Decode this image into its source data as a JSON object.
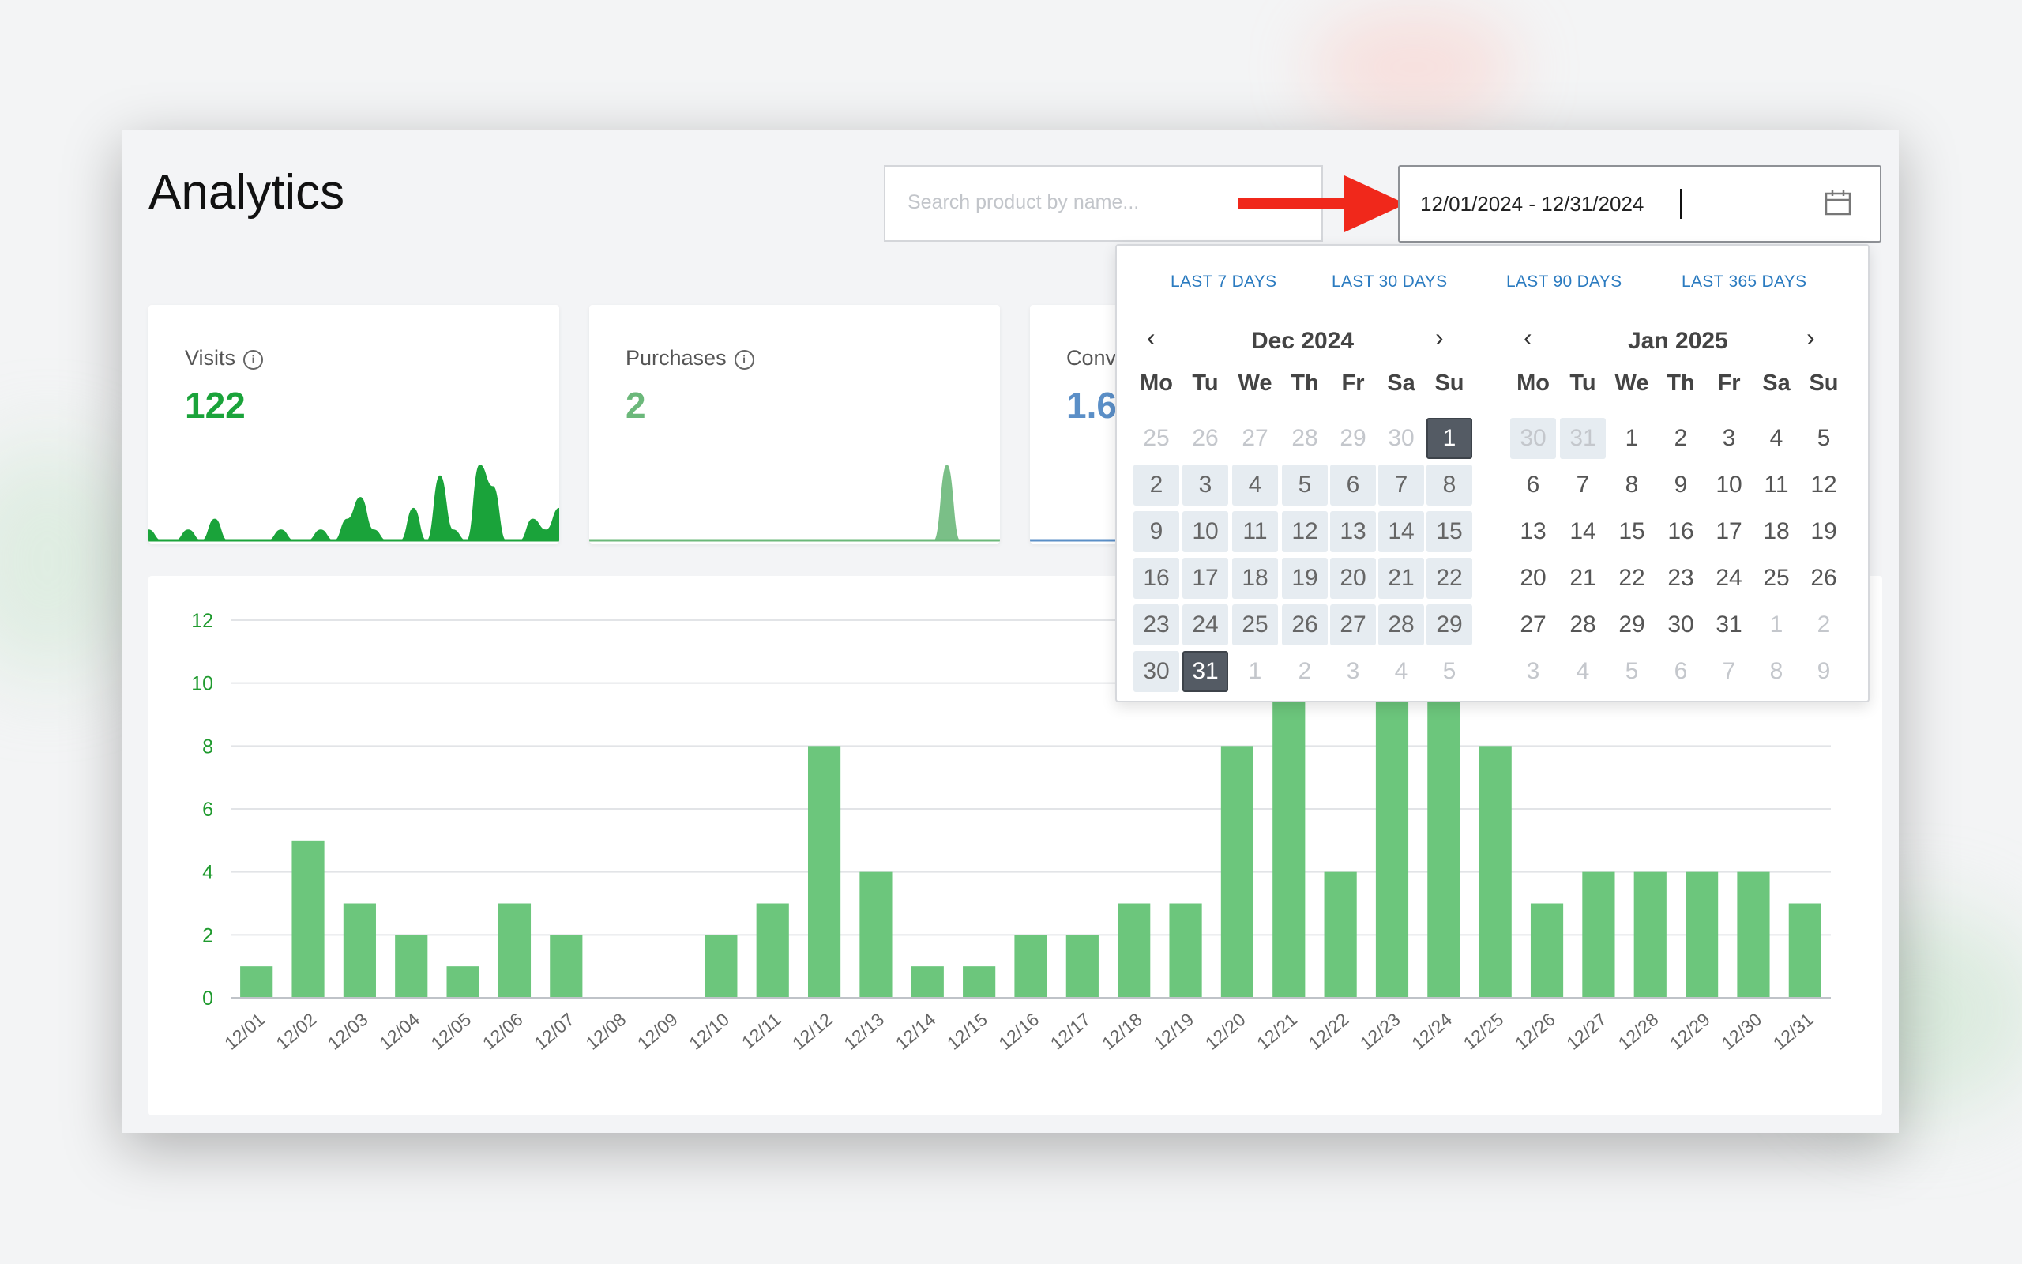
{
  "page": {
    "title": "Analytics"
  },
  "search": {
    "placeholder": "Search product by name..."
  },
  "date_range": {
    "value": "12/01/2024 - 12/31/2024"
  },
  "cards": [
    {
      "label": "Visits",
      "value": "122",
      "color": "#1aa33a",
      "spark": [
        1,
        0,
        0,
        1,
        0,
        2,
        0,
        0,
        0,
        0,
        1,
        0,
        0,
        1,
        0,
        2,
        4,
        1,
        0,
        0,
        3,
        0,
        6,
        1,
        0,
        7,
        5,
        0,
        0,
        2,
        1,
        3
      ]
    },
    {
      "label": "Purchases",
      "value": "2",
      "color": "#6bb87a",
      "spark": [
        0,
        0,
        0,
        0,
        0,
        0,
        0,
        0,
        0,
        0,
        0,
        0,
        0,
        0,
        0,
        0,
        0,
        0,
        0,
        0,
        0,
        0,
        0,
        0,
        0,
        0,
        0,
        2,
        0,
        0,
        0,
        0
      ]
    },
    {
      "label": "Conv",
      "value": "1.6",
      "color": "#5b8fc7",
      "spark": [
        0,
        0,
        0,
        0,
        0,
        0,
        0,
        0,
        0,
        0,
        0,
        0,
        0,
        0,
        0,
        0,
        0,
        0,
        0,
        0,
        0,
        0,
        0,
        0,
        0,
        0,
        0,
        0,
        0,
        0,
        0,
        0
      ]
    }
  ],
  "calendar": {
    "presets": [
      "LAST 7 DAYS",
      "LAST 30 DAYS",
      "LAST 90 DAYS",
      "LAST 365 DAYS"
    ],
    "prev_icon": "chevron-left-icon",
    "next_icon": "chevron-right-icon",
    "weekdays": [
      "Mo",
      "Tu",
      "We",
      "Th",
      "Fr",
      "Sa",
      "Su"
    ],
    "months": [
      {
        "title": "Dec 2024",
        "days": [
          {
            "d": "25",
            "s": "out"
          },
          {
            "d": "26",
            "s": "out"
          },
          {
            "d": "27",
            "s": "out"
          },
          {
            "d": "28",
            "s": "out"
          },
          {
            "d": "29",
            "s": "out"
          },
          {
            "d": "30",
            "s": "out"
          },
          {
            "d": "1",
            "s": "sel"
          },
          {
            "d": "2",
            "s": "rng"
          },
          {
            "d": "3",
            "s": "rng"
          },
          {
            "d": "4",
            "s": "rng"
          },
          {
            "d": "5",
            "s": "rng"
          },
          {
            "d": "6",
            "s": "rng"
          },
          {
            "d": "7",
            "s": "rng"
          },
          {
            "d": "8",
            "s": "rng"
          },
          {
            "d": "9",
            "s": "rng"
          },
          {
            "d": "10",
            "s": "rng"
          },
          {
            "d": "11",
            "s": "rng"
          },
          {
            "d": "12",
            "s": "rng"
          },
          {
            "d": "13",
            "s": "rng"
          },
          {
            "d": "14",
            "s": "rng"
          },
          {
            "d": "15",
            "s": "rng"
          },
          {
            "d": "16",
            "s": "rng"
          },
          {
            "d": "17",
            "s": "rng"
          },
          {
            "d": "18",
            "s": "rng"
          },
          {
            "d": "19",
            "s": "rng"
          },
          {
            "d": "20",
            "s": "rng"
          },
          {
            "d": "21",
            "s": "rng"
          },
          {
            "d": "22",
            "s": "rng"
          },
          {
            "d": "23",
            "s": "rng"
          },
          {
            "d": "24",
            "s": "rng"
          },
          {
            "d": "25",
            "s": "rng"
          },
          {
            "d": "26",
            "s": "rng"
          },
          {
            "d": "27",
            "s": "rng"
          },
          {
            "d": "28",
            "s": "rng"
          },
          {
            "d": "29",
            "s": "rng"
          },
          {
            "d": "30",
            "s": "rng"
          },
          {
            "d": "31",
            "s": "sel"
          },
          {
            "d": "1",
            "s": "out"
          },
          {
            "d": "2",
            "s": "out"
          },
          {
            "d": "3",
            "s": "out"
          },
          {
            "d": "4",
            "s": "out"
          },
          {
            "d": "5",
            "s": "out"
          }
        ]
      },
      {
        "title": "Jan 2025",
        "days": [
          {
            "d": "30",
            "s": "outrng"
          },
          {
            "d": "31",
            "s": "outrng"
          },
          {
            "d": "1",
            "s": ""
          },
          {
            "d": "2",
            "s": ""
          },
          {
            "d": "3",
            "s": ""
          },
          {
            "d": "4",
            "s": ""
          },
          {
            "d": "5",
            "s": ""
          },
          {
            "d": "6",
            "s": ""
          },
          {
            "d": "7",
            "s": ""
          },
          {
            "d": "8",
            "s": ""
          },
          {
            "d": "9",
            "s": ""
          },
          {
            "d": "10",
            "s": ""
          },
          {
            "d": "11",
            "s": ""
          },
          {
            "d": "12",
            "s": ""
          },
          {
            "d": "13",
            "s": ""
          },
          {
            "d": "14",
            "s": ""
          },
          {
            "d": "15",
            "s": ""
          },
          {
            "d": "16",
            "s": ""
          },
          {
            "d": "17",
            "s": ""
          },
          {
            "d": "18",
            "s": ""
          },
          {
            "d": "19",
            "s": ""
          },
          {
            "d": "20",
            "s": ""
          },
          {
            "d": "21",
            "s": ""
          },
          {
            "d": "22",
            "s": ""
          },
          {
            "d": "23",
            "s": ""
          },
          {
            "d": "24",
            "s": ""
          },
          {
            "d": "25",
            "s": ""
          },
          {
            "d": "26",
            "s": ""
          },
          {
            "d": "27",
            "s": ""
          },
          {
            "d": "28",
            "s": ""
          },
          {
            "d": "29",
            "s": ""
          },
          {
            "d": "30",
            "s": ""
          },
          {
            "d": "31",
            "s": ""
          },
          {
            "d": "1",
            "s": "out"
          },
          {
            "d": "2",
            "s": "out"
          },
          {
            "d": "3",
            "s": "out"
          },
          {
            "d": "4",
            "s": "out"
          },
          {
            "d": "5",
            "s": "out"
          },
          {
            "d": "6",
            "s": "out"
          },
          {
            "d": "7",
            "s": "out"
          },
          {
            "d": "8",
            "s": "out"
          },
          {
            "d": "9",
            "s": "out"
          }
        ]
      }
    ]
  },
  "colors": {
    "bar": "#6cc67c",
    "axis_text": "#1f9a2e",
    "range_bg": "#e6ecf1",
    "selected": "#545b64",
    "preset_link": "#2b7bc0",
    "annotation_arrow": "#f0281b"
  },
  "chart_data": {
    "type": "bar",
    "categories": [
      "12/01",
      "12/02",
      "12/03",
      "12/04",
      "12/05",
      "12/06",
      "12/07",
      "12/08",
      "12/09",
      "12/10",
      "12/11",
      "12/12",
      "12/13",
      "12/14",
      "12/15",
      "12/16",
      "12/17",
      "12/18",
      "12/19",
      "12/20",
      "12/21",
      "12/22",
      "12/23",
      "12/24",
      "12/25",
      "12/26",
      "12/27",
      "12/28",
      "12/29",
      "12/30",
      "12/31"
    ],
    "values": [
      1,
      5,
      3,
      2,
      1,
      3,
      2,
      0,
      0,
      2,
      3,
      8,
      4,
      1,
      1,
      2,
      2,
      3,
      3,
      8,
      10,
      4,
      11,
      10,
      8,
      3,
      4,
      4,
      4,
      4,
      3
    ],
    "yticks": [
      "0",
      "2",
      "4",
      "6",
      "8",
      "10",
      "12"
    ],
    "ylim": [
      0,
      12
    ],
    "grid": true,
    "title": "",
    "xlabel": "",
    "ylabel": ""
  }
}
